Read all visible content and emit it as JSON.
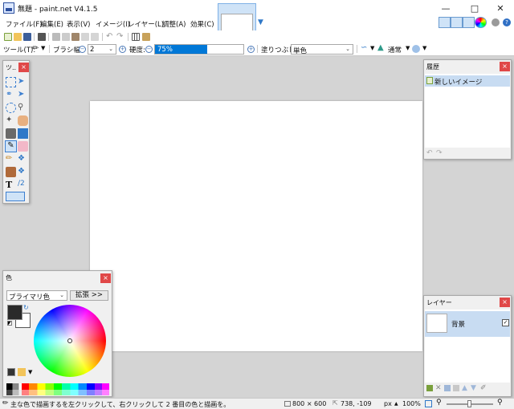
{
  "window": {
    "title": "無題 - paint.net V4.1.5",
    "minimize_icon": "minimize-icon",
    "maximize_icon": "maximize-icon",
    "close_icon": "close-icon"
  },
  "menu": {
    "items": [
      "ファイル(F)",
      "編集(E)",
      "表示(V)",
      "イメージ(I)",
      "レイヤー(L)",
      "調整(A)",
      "効果(C)"
    ]
  },
  "toolbar": {
    "tool_label": "ツール(T):",
    "brush_width_label": "ブラシ幅:",
    "brush_width_value": "2",
    "hardness_label": "硬度:",
    "hardness_value": "75%",
    "hardness_fraction": 0.75,
    "fill_label": "塗りつぶし:",
    "fill_value": "単色",
    "blend_value": "通常"
  },
  "tools_panel": {
    "title": "ツ..",
    "close": "×"
  },
  "history_panel": {
    "title": "履歴",
    "close": "×",
    "items": [
      "新しいイメージ"
    ]
  },
  "colors_panel": {
    "title": "色",
    "close": "×",
    "mode_value": "プライマリ色",
    "expand_label": "拡張 >>",
    "primary_color": "#2a2a2a",
    "secondary_color": "#ffffff"
  },
  "layers_panel": {
    "title": "レイヤー",
    "close": "×",
    "layers": [
      {
        "name": "背景",
        "visible": true
      }
    ]
  },
  "status": {
    "hint": "主な色で描画するを左クリックして、右クリックして 2 番目の色と描画を。",
    "image_size": "800 × 600",
    "cursor_position": "738, -109",
    "units": "px",
    "zoom": "100%"
  },
  "colors": {
    "accent": "#0078d7",
    "selection": "#c8dcf2",
    "close_red": "#e04848"
  }
}
